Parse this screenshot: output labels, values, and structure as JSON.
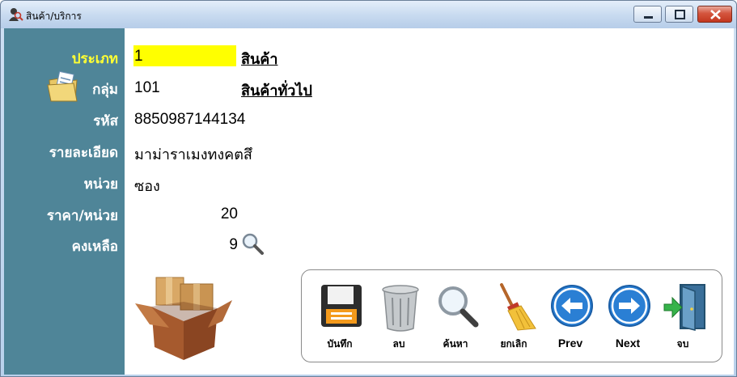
{
  "window": {
    "title": "สินค้า/บริการ"
  },
  "form": {
    "type": {
      "label": "ประเภท",
      "value": "1",
      "link": "สินค้า"
    },
    "group": {
      "label": "กลุ่ม",
      "value": "101",
      "link": "สินค้าทั่วไป"
    },
    "code": {
      "label": "รหัส",
      "value": "8850987144134"
    },
    "description": {
      "label": "รายละเอียด",
      "value": "มาม่าราเมงทงคตสึ"
    },
    "unit": {
      "label": "หน่วย",
      "value": "ซอง"
    },
    "price": {
      "label": "ราคา/หน่วย",
      "value": "20"
    },
    "stock": {
      "label": "คงเหลือ",
      "value": "9"
    }
  },
  "toolbar": {
    "save": "บันทึก",
    "delete": "ลบ",
    "search": "ค้นหา",
    "cancel": "ยกเลิก",
    "prev": "Prev",
    "next": "Next",
    "exit": "จบ"
  },
  "icons": {
    "title": "user-search-icon",
    "group": "folder-documents-icon",
    "stock_lookup": "magnifier-icon",
    "product": "cardboard-boxes-icon",
    "save": "floppy-disk-icon",
    "delete": "trash-can-icon",
    "search": "magnifier-icon",
    "cancel": "broom-icon",
    "prev": "arrow-left-circle-icon",
    "next": "arrow-right-circle-icon",
    "exit": "exit-door-icon"
  },
  "colors": {
    "label_panel": "#4f8598",
    "highlight_label": "#ffff33",
    "type_field": "#ffff00"
  }
}
